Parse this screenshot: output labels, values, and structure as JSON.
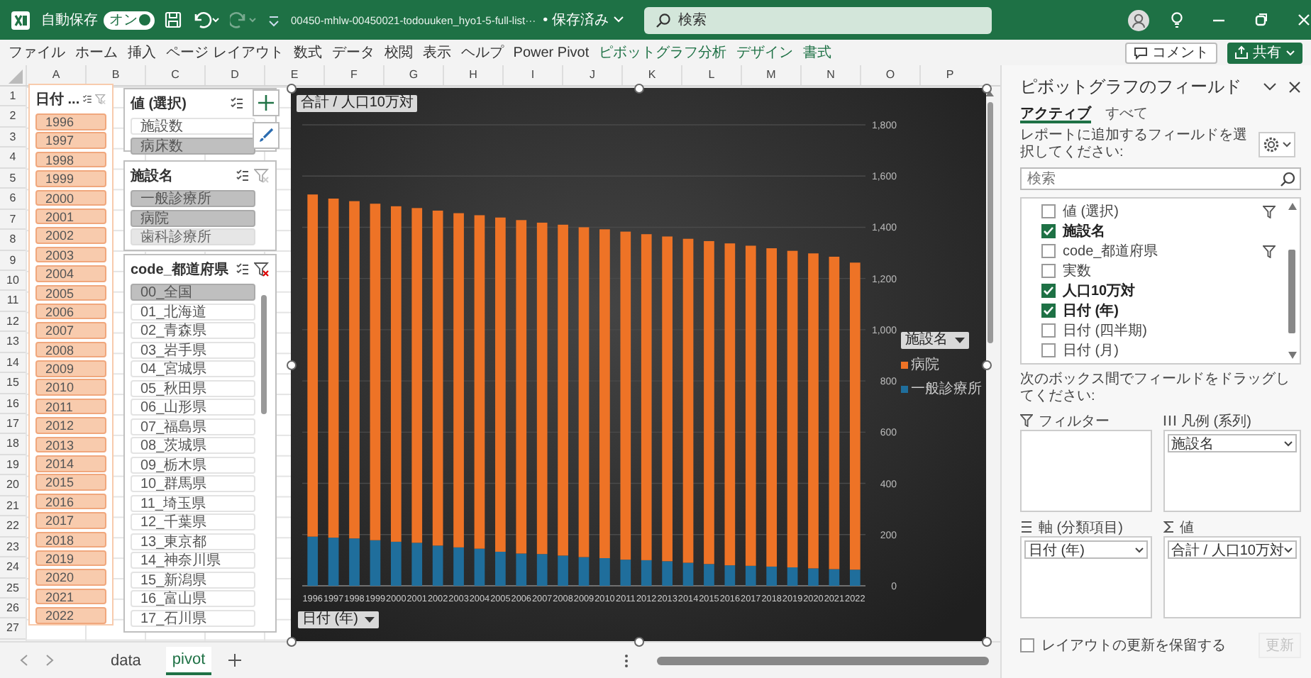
{
  "title_bar": {
    "autosave_label": "自動保存",
    "autosave_toggle": {
      "label": "オン",
      "on": true
    },
    "redo": {
      "disabled": true
    },
    "file_name": "00450-mhlw-00450021-todouuken_hyo1-5-full-list···",
    "save_status": "• 保存済み",
    "search": {
      "placeholder": "検索"
    }
  },
  "menu": [
    {
      "label": "ファイル",
      "contextual": false
    },
    {
      "label": "ホーム",
      "contextual": false
    },
    {
      "label": "挿入",
      "contextual": false
    },
    {
      "label": "ページ レイアウト",
      "contextual": false
    },
    {
      "label": "数式",
      "contextual": false
    },
    {
      "label": "データ",
      "contextual": false
    },
    {
      "label": "校閲",
      "contextual": false
    },
    {
      "label": "表示",
      "contextual": false
    },
    {
      "label": "ヘルプ",
      "contextual": false
    },
    {
      "label": "Power Pivot",
      "contextual": false
    },
    {
      "label": "ピボットグラフ分析",
      "contextual": true
    },
    {
      "label": "デザイン",
      "contextual": true
    },
    {
      "label": "書式",
      "contextual": true
    }
  ],
  "comment_button": "コメント",
  "share_button": "共有",
  "columns": [
    "A",
    "B",
    "C",
    "D",
    "E",
    "F",
    "G",
    "H",
    "I",
    "J",
    "K",
    "L",
    "M",
    "N",
    "O",
    "P"
  ],
  "rows": [
    "1",
    "2",
    "3",
    "4",
    "5",
    "6",
    "7",
    "8",
    "9",
    "10",
    "11",
    "12",
    "13",
    "14",
    "15",
    "16",
    "17",
    "18",
    "19",
    "20",
    "21",
    "22",
    "23",
    "24",
    "25",
    "26",
    "27"
  ],
  "slicers": [
    {
      "title": "日付 ...",
      "color": "#f8cbad",
      "filter_active": false,
      "items": [
        {
          "label": "1996",
          "selected": true
        },
        {
          "label": "1997",
          "selected": true
        },
        {
          "label": "1998",
          "selected": true
        },
        {
          "label": "1999",
          "selected": true
        },
        {
          "label": "2000",
          "selected": true
        },
        {
          "label": "2001",
          "selected": true
        },
        {
          "label": "2002",
          "selected": true
        },
        {
          "label": "2003",
          "selected": true
        },
        {
          "label": "2004",
          "selected": true
        },
        {
          "label": "2005",
          "selected": true
        },
        {
          "label": "2006",
          "selected": true
        },
        {
          "label": "2007",
          "selected": true
        },
        {
          "label": "2008",
          "selected": true
        },
        {
          "label": "2009",
          "selected": true
        },
        {
          "label": "2010",
          "selected": true
        },
        {
          "label": "2011",
          "selected": true
        },
        {
          "label": "2012",
          "selected": true
        },
        {
          "label": "2013",
          "selected": true
        },
        {
          "label": "2014",
          "selected": true
        },
        {
          "label": "2015",
          "selected": true
        },
        {
          "label": "2016",
          "selected": true
        },
        {
          "label": "2017",
          "selected": true
        },
        {
          "label": "2018",
          "selected": true
        },
        {
          "label": "2019",
          "selected": true
        },
        {
          "label": "2020",
          "selected": true
        },
        {
          "label": "2021",
          "selected": true
        },
        {
          "label": "2022",
          "selected": true
        }
      ]
    },
    {
      "title": "値 (選択)",
      "color": "#bfbfbf",
      "items": [
        {
          "label": "施設数",
          "selected": false
        },
        {
          "label": "病床数",
          "selected": true
        }
      ]
    },
    {
      "title": "施設名",
      "color": "#bfbfbf",
      "filter_active": false,
      "items": [
        {
          "label": "一般診療所",
          "selected": true,
          "has_data": true
        },
        {
          "label": "病院",
          "selected": true,
          "has_data": true
        },
        {
          "label": "歯科診療所",
          "selected": true,
          "has_data": false
        }
      ]
    },
    {
      "title": "code_都道府県",
      "color": "#bfbfbf",
      "filter_active": true,
      "items": [
        {
          "label": "00_全国",
          "selected": true
        },
        {
          "label": "01_北海道",
          "selected": false
        },
        {
          "label": "02_青森県",
          "selected": false
        },
        {
          "label": "03_岩手県",
          "selected": false
        },
        {
          "label": "04_宮城県",
          "selected": false
        },
        {
          "label": "05_秋田県",
          "selected": false
        },
        {
          "label": "06_山形県",
          "selected": false
        },
        {
          "label": "07_福島県",
          "selected": false
        },
        {
          "label": "08_茨城県",
          "selected": false
        },
        {
          "label": "09_栃木県",
          "selected": false
        },
        {
          "label": "10_群馬県",
          "selected": false
        },
        {
          "label": "11_埼玉県",
          "selected": false
        },
        {
          "label": "12_千葉県",
          "selected": false
        },
        {
          "label": "13_東京都",
          "selected": false
        },
        {
          "label": "14_神奈川県",
          "selected": false
        },
        {
          "label": "15_新潟県",
          "selected": false
        },
        {
          "label": "16_富山県",
          "selected": false
        },
        {
          "label": "17_石川県",
          "selected": false
        }
      ]
    }
  ],
  "chart": {
    "field_buttons": [
      {
        "kind": "values",
        "label": "合計 / 人口10万対"
      },
      {
        "kind": "legend",
        "label": "施設名"
      },
      {
        "kind": "axis",
        "label": "日付 (年)"
      }
    ],
    "chart_data": {
      "type": "bar",
      "stacked": true,
      "grid": true,
      "legend": true,
      "categories": [
        "1996",
        "1997",
        "1998",
        "1999",
        "2000",
        "2001",
        "2002",
        "2003",
        "2004",
        "2005",
        "2006",
        "2007",
        "2008",
        "2009",
        "2010",
        "2011",
        "2012",
        "2013",
        "2014",
        "2015",
        "2016",
        "2017",
        "2018",
        "2019",
        "2020",
        "2021",
        "2022"
      ],
      "ylim": [
        0,
        1800
      ],
      "yticks": [
        0,
        200,
        400,
        600,
        800,
        {
          "value": 1000,
          "label": "1,000"
        },
        {
          "value": 1200,
          "label": "1,200"
        },
        {
          "value": 1400,
          "label": "1,400"
        },
        {
          "value": 1600,
          "label": "1,600"
        },
        {
          "value": 1800,
          "label": "1,800"
        }
      ],
      "series": [
        {
          "name": "一般診療所",
          "color": "#1f6e9c",
          "values": [
            192,
            188,
            185,
            178,
            172,
            168,
            157,
            150,
            145,
            133,
            126,
            124,
            118,
            112,
            108,
            102,
            100,
            96,
            90,
            85,
            80,
            78,
            75,
            72,
            68,
            65,
            63
          ]
        },
        {
          "name": "病院",
          "color": "#ee7326",
          "values": [
            1336,
            1324,
            1317,
            1314,
            1310,
            1307,
            1308,
            1305,
            1302,
            1305,
            1302,
            1294,
            1292,
            1288,
            1284,
            1281,
            1273,
            1268,
            1265,
            1261,
            1257,
            1250,
            1243,
            1236,
            1230,
            1220,
            1199
          ]
        }
      ]
    }
  },
  "sheet_tabs": [
    {
      "label": "data",
      "selected": false
    },
    {
      "label": "pivot",
      "selected": true
    }
  ],
  "field_pane": {
    "title": "ピボットグラフのフィールド",
    "tabs": [
      {
        "label": "アクティブ",
        "selected": true
      },
      {
        "label": "すべて",
        "selected": false
      }
    ],
    "instruction": "レポートに追加するフィールドを選択してください:",
    "search": {
      "placeholder": "検索"
    },
    "fields": [
      {
        "label": "値 (選択)",
        "checked": false,
        "filtered": true
      },
      {
        "label": "施設名",
        "checked": true,
        "filtered": false
      },
      {
        "label": "code_都道府県",
        "checked": false,
        "filtered": true
      },
      {
        "label": "実数",
        "checked": false,
        "filtered": false
      },
      {
        "label": "人口10万対",
        "checked": true,
        "filtered": false
      },
      {
        "label": "日付 (年)",
        "checked": true,
        "filtered": false
      },
      {
        "label": "日付 (四半期)",
        "checked": false,
        "filtered": false
      },
      {
        "label": "日付 (月)",
        "checked": false,
        "filtered": false
      }
    ],
    "drag_instruction": "次のボックス間でフィールドをドラッグしてください:",
    "areas": [
      {
        "kind": "filter",
        "label": "フィルター"
      },
      {
        "kind": "legend",
        "label": "凡例 (系列)",
        "fields": [
          "施設名"
        ]
      },
      {
        "kind": "axis",
        "label": "軸 (分類項目)",
        "fields": [
          "日付 (年)"
        ]
      },
      {
        "kind": "values",
        "label": "値",
        "fields": [
          "合計 / 人口10万対"
        ]
      }
    ],
    "defer_update": {
      "label": "レイアウトの更新を保留する",
      "checked": false
    },
    "update_button": {
      "label": "更新",
      "disabled": true
    }
  }
}
